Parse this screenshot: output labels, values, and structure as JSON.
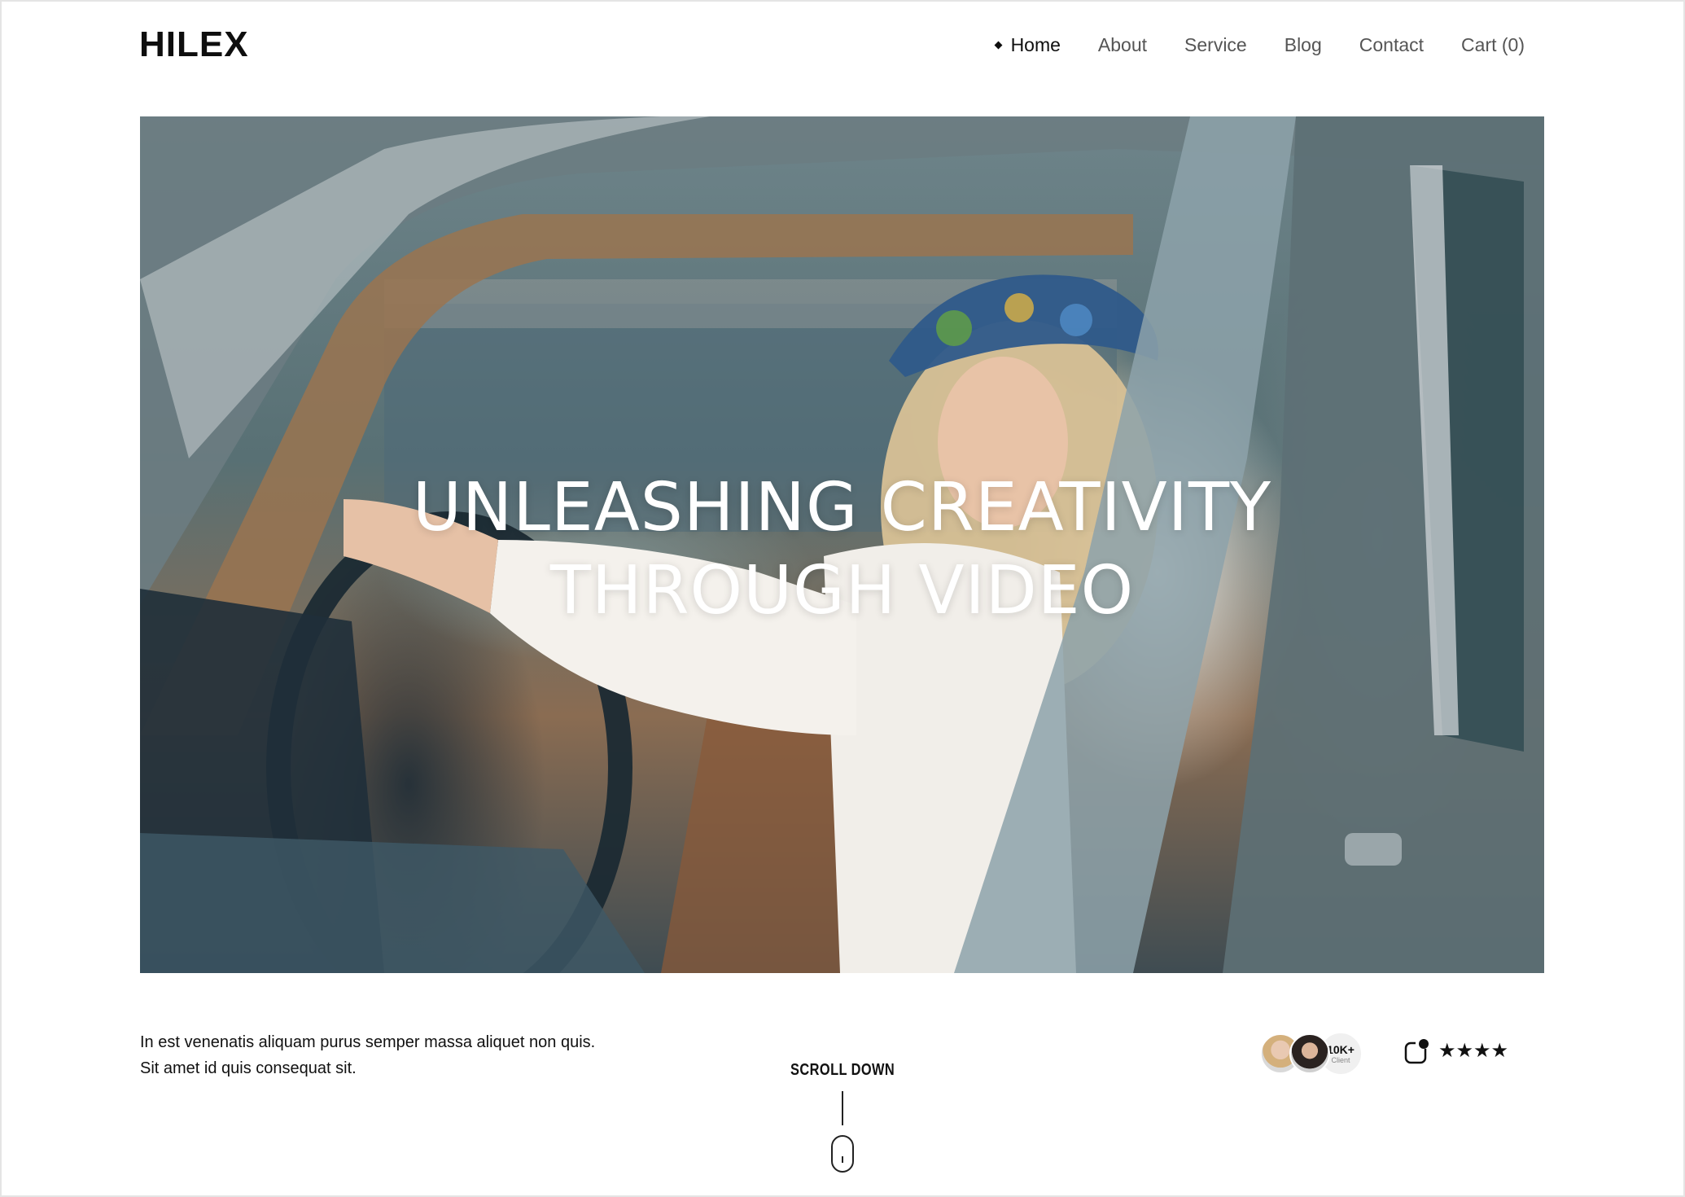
{
  "brand": {
    "logo": "HILEX"
  },
  "nav": {
    "items": [
      {
        "label": "Home",
        "active": true
      },
      {
        "label": "About",
        "active": false
      },
      {
        "label": "Service",
        "active": false
      },
      {
        "label": "Blog",
        "active": false
      },
      {
        "label": "Contact",
        "active": false
      },
      {
        "label": "Cart (0)",
        "active": false
      }
    ]
  },
  "hero": {
    "title_line1": "UNLEASHING CREATIVITY",
    "title_line2": "THROUGH VIDEO",
    "image": "woman-in-car-photo"
  },
  "intro": {
    "line1": "In est venenatis aliquam purus semper massa aliquet non quis.",
    "line2": "Sit amet id quis consequat sit."
  },
  "scroll": {
    "label": "SCROLL DOWN",
    "icon": "mouse-icon"
  },
  "clients": {
    "count": "10K+",
    "label": "Client",
    "avatars": [
      "avatar-blonde-woman",
      "avatar-dark-hair-woman"
    ]
  },
  "rating": {
    "icon": "notification-icon",
    "stars": 4,
    "star_glyph": "★★★★"
  },
  "colors": {
    "text": "#111111",
    "nav_inactive": "#555555",
    "hero_text": "#ffffff",
    "background": "#ffffff"
  }
}
